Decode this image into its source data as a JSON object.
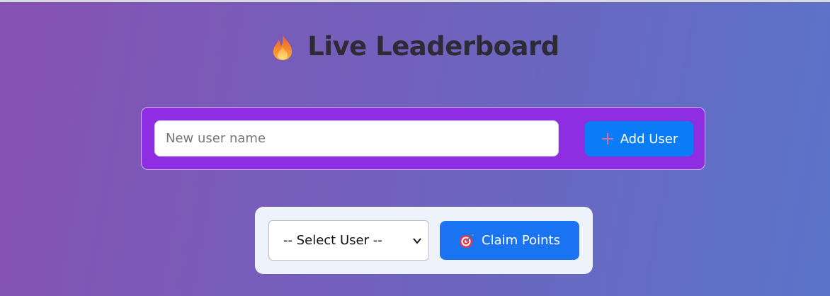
{
  "header": {
    "title": "Live Leaderboard",
    "icon": "fire-icon"
  },
  "add_user": {
    "input_placeholder": "New user name",
    "input_value": "",
    "button_label": "Add User",
    "button_icon": "plus-icon"
  },
  "claim": {
    "select_selected": "-- Select User --",
    "button_label": "Claim Points",
    "button_icon": "target-icon"
  },
  "colors": {
    "add_panel_bg": "#8e2de2",
    "add_button_bg": "#0a7cf5",
    "claim_button_bg": "#1a73f0",
    "claim_panel_bg": "#eef2fa",
    "title_color": "#2e2a36"
  }
}
